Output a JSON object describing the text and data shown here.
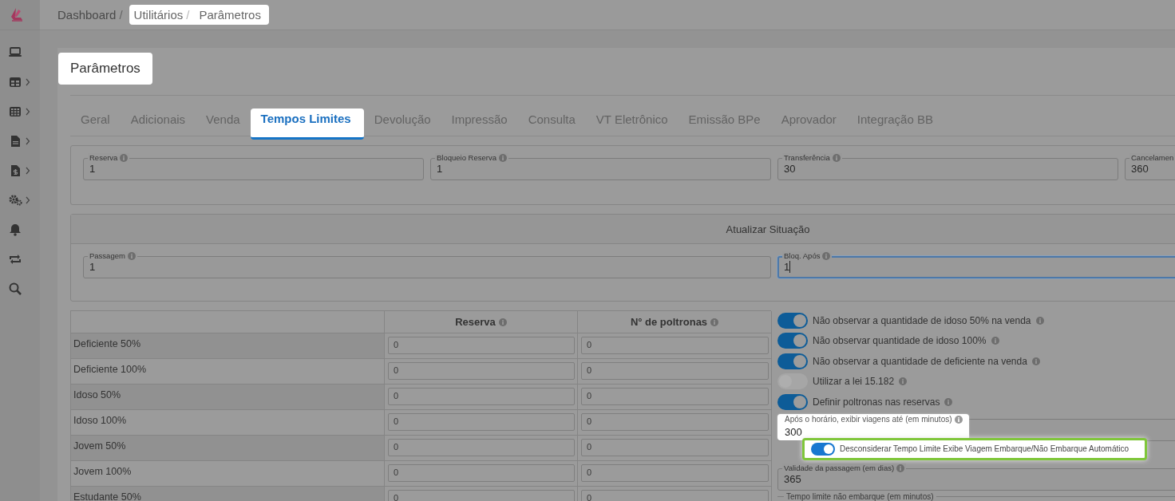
{
  "sidebar": {
    "items": [
      {
        "kind": "laptop",
        "expandable": false
      },
      {
        "kind": "panels",
        "expandable": true
      },
      {
        "kind": "grid",
        "expandable": true
      },
      {
        "kind": "document",
        "expandable": true
      },
      {
        "kind": "invoice",
        "expandable": true
      },
      {
        "kind": "gears",
        "expandable": true
      },
      {
        "kind": "bell",
        "expandable": false
      },
      {
        "kind": "sync",
        "expandable": false
      },
      {
        "kind": "search",
        "expandable": false
      }
    ]
  },
  "breadcrumb": [
    {
      "label": "Dashboard",
      "separator": "/",
      "highlighted": false
    },
    {
      "label": "Utilitários",
      "separator": "/",
      "highlighted": true
    },
    {
      "label": "Parâmetros",
      "highlighted": true
    }
  ],
  "page_title": {
    "text": "Parâmetros",
    "highlighted": true
  },
  "tabs": [
    {
      "label": "Geral",
      "selected": false
    },
    {
      "label": "Adicionais",
      "selected": false
    },
    {
      "label": "Venda",
      "selected": false
    },
    {
      "label": "Tempos Limites",
      "selected": true
    },
    {
      "label": "Devolução",
      "selected": false
    },
    {
      "label": "Impressão",
      "selected": false
    },
    {
      "label": "Consulta",
      "selected": false
    },
    {
      "label": "VT Eletrônico",
      "selected": false
    },
    {
      "label": "Emissão BPe",
      "selected": false
    },
    {
      "label": "Aprovador",
      "selected": false
    },
    {
      "label": "Integração BB",
      "selected": false
    }
  ],
  "limits": [
    {
      "label": "Reserva",
      "value": "1"
    },
    {
      "label": "Bloqueio Reserva",
      "value": "1"
    },
    {
      "label": "Transferência",
      "value": "30"
    },
    {
      "label": "Cancelamen",
      "value": "360"
    }
  ],
  "update_status": {
    "title": "Atualizar Situação",
    "fields": [
      {
        "label": "Passagem",
        "value": "1",
        "focused": false
      },
      {
        "label": "Bloq. Após",
        "value": "1",
        "focused": true
      }
    ]
  },
  "seat_table": {
    "columns": [
      "Reserva",
      "N° de poltronas"
    ],
    "rows": [
      {
        "label": "Deficiente 50%",
        "reserva": "0",
        "poltronas": "0"
      },
      {
        "label": "Deficiente 100%",
        "reserva": "0",
        "poltronas": "0"
      },
      {
        "label": "Idoso 50%",
        "reserva": "0",
        "poltronas": "0"
      },
      {
        "label": "Idoso 100%",
        "reserva": "0",
        "poltronas": "0"
      },
      {
        "label": "Jovem 50%",
        "reserva": "0",
        "poltronas": "0"
      },
      {
        "label": "Jovem 100%",
        "reserva": "0",
        "poltronas": "0"
      },
      {
        "label": "Estudante 50%",
        "reserva": "0",
        "poltronas": "0"
      }
    ]
  },
  "switches": [
    {
      "label": "Não observar a quantidade de idoso 50% na venda",
      "on": true
    },
    {
      "label": "Não observar quantidade de idoso 100%",
      "on": true
    },
    {
      "label": "Não observar a quantidade de deficiente na venda",
      "on": true
    },
    {
      "label": "Utilizar a lei 15.182",
      "on": false
    },
    {
      "label": "Definir poltronas nas reservas",
      "on": true
    }
  ],
  "display_after": {
    "label": "Após o horário, exibir viagens até (em minutos)",
    "value": "300",
    "highlighted": true
  },
  "ignore_limit": {
    "label": "Desconsiderar Tempo Limite Exibe Viagem Embarque/Não Embarque Automático",
    "on": true,
    "highlighted": true
  },
  "validity": {
    "label": "Validade da passagem (em dias)",
    "value": "365"
  },
  "no_boarding_limit": {
    "label": "Tempo limite não embarque (em minutos)"
  }
}
